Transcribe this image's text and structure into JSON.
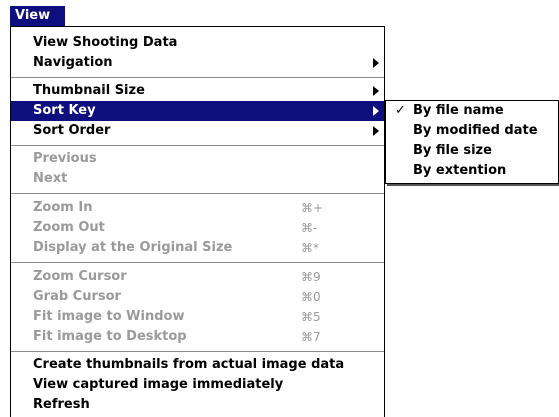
{
  "menu_title": "View",
  "items": [
    {
      "label": "View Shooting Data"
    },
    {
      "label": "Navigation"
    },
    {
      "label": "Thumbnail Size"
    },
    {
      "label": "Sort Key"
    },
    {
      "label": "Sort Order"
    },
    {
      "label": "Previous"
    },
    {
      "label": "Next"
    },
    {
      "label": "Zoom In",
      "shortcut": "⌘+"
    },
    {
      "label": "Zoom Out",
      "shortcut": "⌘-"
    },
    {
      "label": "Display at the Original Size",
      "shortcut": "⌘*"
    },
    {
      "label": "Zoom Cursor",
      "shortcut": "⌘9"
    },
    {
      "label": "Grab Cursor",
      "shortcut": "⌘0"
    },
    {
      "label": "Fit image to Window",
      "shortcut": "⌘5"
    },
    {
      "label": "Fit image to Desktop",
      "shortcut": "⌘7"
    },
    {
      "label": "Create thumbnails from actual image data"
    },
    {
      "label": "View captured image immediately"
    },
    {
      "label": "Refresh"
    }
  ],
  "submenu": {
    "check_mark": "✓",
    "items": [
      {
        "label": "By file name"
      },
      {
        "label": "By modified date"
      },
      {
        "label": "By file size"
      },
      {
        "label": "By extention"
      }
    ]
  },
  "colors": {
    "highlight": "#0e0e7e",
    "disabled": "#9a9a9a"
  }
}
